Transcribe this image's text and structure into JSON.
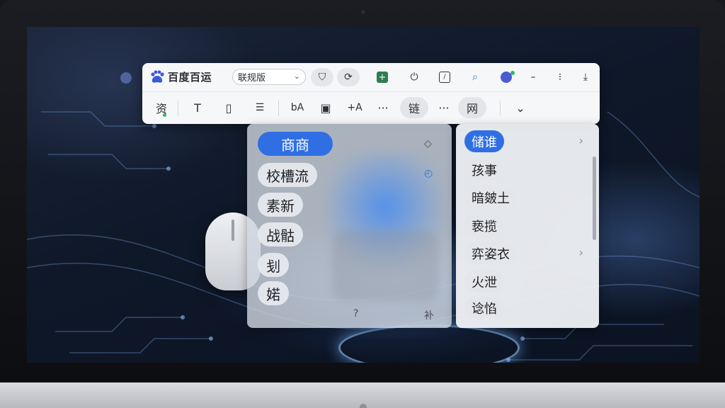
{
  "toolbar": {
    "brand_text": "百度百运",
    "version_select": "联规版",
    "row1_icons": [
      "bookmark-icon",
      "refresh-circle-icon",
      "plus-square-icon",
      "power-icon",
      "clock-square-icon",
      "search-user-icon",
      "avatar-icon",
      "minimize-icon",
      "more-icon",
      "close-icon"
    ],
    "row1_glyphs": {
      "minimize": "–",
      "more": "⁝",
      "close": "⤓"
    },
    "row2": {
      "res_label": "资",
      "text_tool": "T",
      "divider_tool": "▯",
      "list_tool": "☰",
      "font_tool": "bA",
      "image_tool": "▣",
      "formula_tool": "+A",
      "more1": "···",
      "link_label": "链",
      "more2": "···",
      "web_label": "网",
      "expand": "⌄"
    }
  },
  "left_menu": {
    "items": [
      "商商",
      "校槽流",
      "素新",
      "战骷",
      "刬",
      "婼"
    ],
    "selected_index": 0,
    "footer_left": "?",
    "footer_right": "补"
  },
  "right_menu": {
    "items": [
      "储谁",
      "孩事",
      "暗皴土",
      "亵揽",
      "弈姿衣",
      "火泄",
      "谂惂"
    ],
    "selected_index": 0,
    "has_submenu": [
      true,
      false,
      false,
      false,
      true,
      false,
      false
    ]
  },
  "colors": {
    "accent": "#2f6fe3",
    "toolbar_bg": "#f6f7f9",
    "status_green": "#2dbd5a"
  }
}
